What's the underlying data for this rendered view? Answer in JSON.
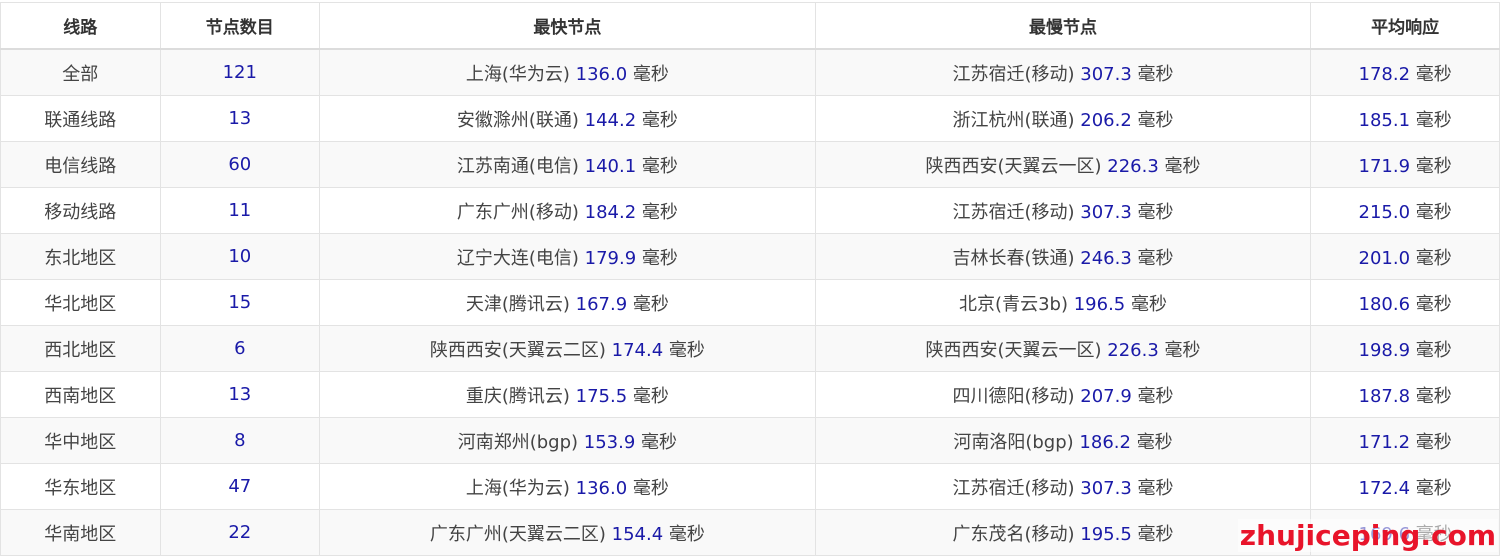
{
  "headers": [
    "线路",
    "节点数目",
    "最快节点",
    "最慢节点",
    "平均响应"
  ],
  "unit": "毫秒",
  "rows": [
    {
      "line": "全部",
      "count": "121",
      "fast_name": "上海(华为云)",
      "fast_ms": "136.0",
      "slow_name": "江苏宿迁(移动)",
      "slow_ms": "307.3",
      "avg_ms": "178.2"
    },
    {
      "line": "联通线路",
      "count": "13",
      "fast_name": "安徽滁州(联通)",
      "fast_ms": "144.2",
      "slow_name": "浙江杭州(联通)",
      "slow_ms": "206.2",
      "avg_ms": "185.1"
    },
    {
      "line": "电信线路",
      "count": "60",
      "fast_name": "江苏南通(电信)",
      "fast_ms": "140.1",
      "slow_name": "陕西西安(天翼云一区)",
      "slow_ms": "226.3",
      "avg_ms": "171.9"
    },
    {
      "line": "移动线路",
      "count": "11",
      "fast_name": "广东广州(移动)",
      "fast_ms": "184.2",
      "slow_name": "江苏宿迁(移动)",
      "slow_ms": "307.3",
      "avg_ms": "215.0"
    },
    {
      "line": "东北地区",
      "count": "10",
      "fast_name": "辽宁大连(电信)",
      "fast_ms": "179.9",
      "slow_name": "吉林长春(铁通)",
      "slow_ms": "246.3",
      "avg_ms": "201.0"
    },
    {
      "line": "华北地区",
      "count": "15",
      "fast_name": "天津(腾讯云)",
      "fast_ms": "167.9",
      "slow_name": "北京(青云3b)",
      "slow_ms": "196.5",
      "avg_ms": "180.6"
    },
    {
      "line": "西北地区",
      "count": "6",
      "fast_name": "陕西西安(天翼云二区)",
      "fast_ms": "174.4",
      "slow_name": "陕西西安(天翼云一区)",
      "slow_ms": "226.3",
      "avg_ms": "198.9"
    },
    {
      "line": "西南地区",
      "count": "13",
      "fast_name": "重庆(腾讯云)",
      "fast_ms": "175.5",
      "slow_name": "四川德阳(移动)",
      "slow_ms": "207.9",
      "avg_ms": "187.8"
    },
    {
      "line": "华中地区",
      "count": "8",
      "fast_name": "河南郑州(bgp)",
      "fast_ms": "153.9",
      "slow_name": "河南洛阳(bgp)",
      "slow_ms": "186.2",
      "avg_ms": "171.2"
    },
    {
      "line": "华东地区",
      "count": "47",
      "fast_name": "上海(华为云)",
      "fast_ms": "136.0",
      "slow_name": "江苏宿迁(移动)",
      "slow_ms": "307.3",
      "avg_ms": "172.4"
    },
    {
      "line": "华南地区",
      "count": "22",
      "fast_name": "广东广州(天翼云二区)",
      "fast_ms": "154.4",
      "slow_name": "广东茂名(移动)",
      "slow_ms": "195.5",
      "avg_ms": "169.6"
    }
  ],
  "watermark": "zhujiceping.com"
}
